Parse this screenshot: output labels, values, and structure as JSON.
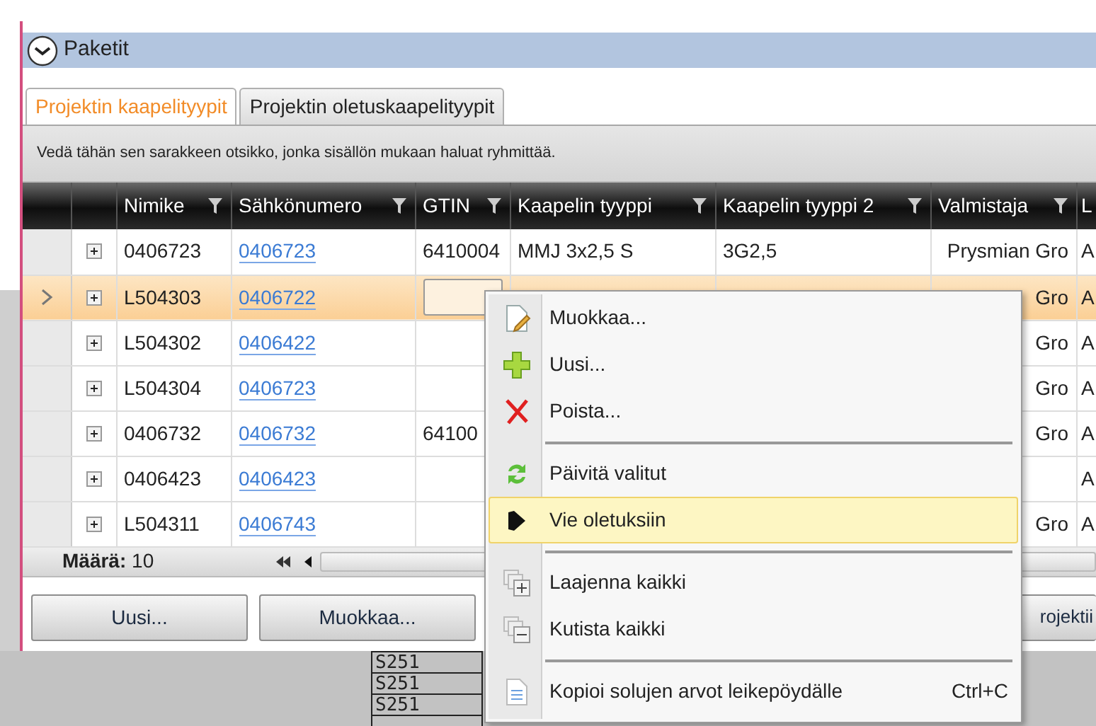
{
  "panel": {
    "title": "Paketit",
    "expanded": true
  },
  "tabs": [
    {
      "label": "Projektin kaapelityypit",
      "selected": true
    },
    {
      "label": "Projektin oletuskaapelityypit",
      "selected": false
    }
  ],
  "group_hint": "Vedä tähän sen sarakkeen otsikko, jonka sisällön mukaan haluat ryhmittää.",
  "grid": {
    "columns": [
      {
        "label": "Nimike",
        "kind": "text",
        "filter": true
      },
      {
        "label": "Sähkönumero",
        "kind": "link",
        "filter": true
      },
      {
        "label": "GTIN",
        "kind": "text",
        "filter": true
      },
      {
        "label": "Kaapelin tyyppi",
        "kind": "text",
        "filter": true
      },
      {
        "label": "Kaapelin tyyppi 2",
        "kind": "text",
        "filter": true
      },
      {
        "label": "Valmistaja",
        "kind": "text",
        "filter": true
      },
      {
        "label": "L",
        "kind": "text"
      }
    ],
    "rows": [
      {
        "current": false,
        "selected": false,
        "expanded": false,
        "gtin_editing": false,
        "cells": [
          "0406723",
          "0406723",
          "6410004",
          "MMJ 3x2,5 S",
          "3G2,5",
          "Prysmian Gro",
          "A"
        ]
      },
      {
        "current": true,
        "selected": true,
        "expanded": false,
        "gtin_editing": true,
        "cells": [
          "L504303",
          "0406722",
          null,
          null,
          null,
          "Gro",
          "A"
        ]
      },
      {
        "current": false,
        "selected": false,
        "expanded": false,
        "gtin_editing": false,
        "cells": [
          "L504302",
          "0406422",
          null,
          null,
          null,
          "Gro",
          "A"
        ]
      },
      {
        "current": false,
        "selected": false,
        "expanded": false,
        "gtin_editing": false,
        "cells": [
          "L504304",
          "0406723",
          null,
          null,
          null,
          "Gro",
          "A"
        ]
      },
      {
        "current": false,
        "selected": false,
        "expanded": false,
        "gtin_editing": false,
        "cells": [
          "0406732",
          "0406732",
          "64100",
          null,
          null,
          "Gro",
          "A"
        ]
      },
      {
        "current": false,
        "selected": false,
        "expanded": false,
        "gtin_editing": false,
        "cells": [
          "0406423",
          "0406423",
          null,
          null,
          null,
          null,
          "A"
        ]
      },
      {
        "current": false,
        "selected": false,
        "expanded": false,
        "gtin_editing": false,
        "cells": [
          "L504311",
          "0406743",
          null,
          null,
          null,
          "Gro",
          "A"
        ]
      }
    ],
    "footer": "**Määrä:** 10"
  },
  "buttons": [
    {
      "label": "Uusi..."
    },
    {
      "label": "Muokkaa..."
    },
    {
      "label": "rojektii"
    }
  ],
  "context_menu": {
    "groups": [
      [
        {
          "label": "Muokkaa...",
          "kind": "edit",
          "selected": false
        },
        {
          "label": "Uusi...",
          "kind": "add",
          "selected": false
        },
        {
          "label": "Poista...",
          "kind": "delete",
          "selected": false
        }
      ],
      [
        {
          "label": "Päivitä valitut",
          "kind": "refresh",
          "selected": false
        },
        {
          "label": "Vie oletuksiin",
          "kind": "export",
          "selected": true
        }
      ],
      [
        {
          "label": "Laajenna kaikki",
          "kind": "expand",
          "selected": false
        },
        {
          "label": "Kutista kaikki",
          "kind": "collapse",
          "selected": false
        }
      ],
      [
        {
          "label": "Kopioi solujen arvot leikepöydälle",
          "kind": "copy",
          "selected": false,
          "shortcut": "Ctrl+C"
        }
      ]
    ]
  },
  "background_table": [
    "S251",
    "S251",
    "S251"
  ]
}
